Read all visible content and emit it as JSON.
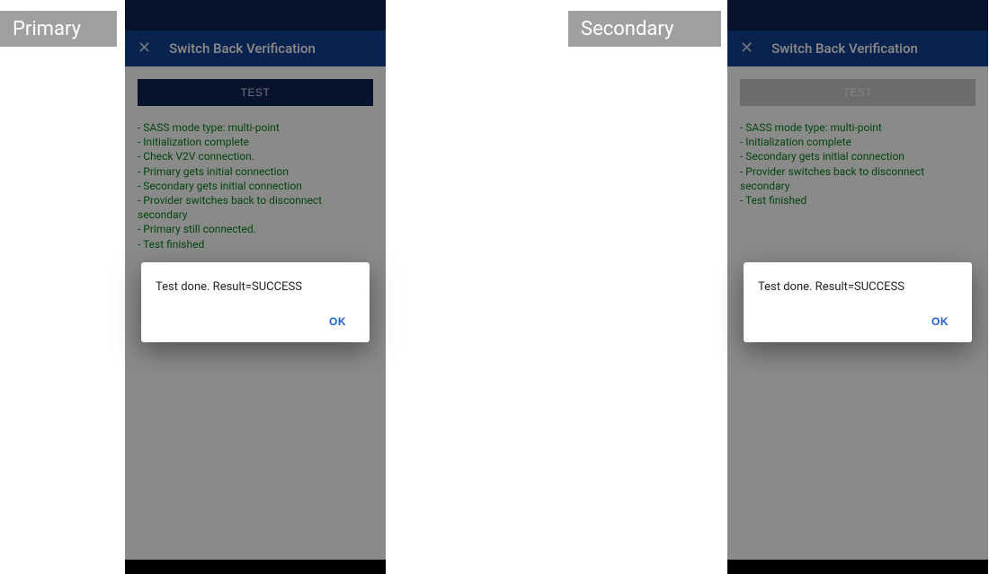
{
  "labels": {
    "primary": "Primary",
    "secondary": "Secondary"
  },
  "primary": {
    "app_bar": {
      "close": "✕",
      "title": "Switch Back Verification"
    },
    "test_button": "TEST",
    "log": [
      "- SASS mode type: multi-point",
      "- Initialization complete",
      "- Check V2V connection.",
      "- Primary gets initial connection",
      "- Secondary gets initial connection",
      "- Provider switches back to disconnect secondary",
      "- Primary still connected.",
      "- Test finished"
    ],
    "dialog": {
      "message": "Test done. Result=SUCCESS",
      "ok": "OK"
    }
  },
  "secondary": {
    "app_bar": {
      "close": "✕",
      "title": "Switch Back Verification"
    },
    "test_button": "TEST",
    "log": [
      "- SASS mode type: multi-point",
      "- Initialization complete",
      "- Secondary gets initial connection",
      "- Provider switches back to disconnect secondary",
      "- Test finished"
    ],
    "dialog": {
      "message": "Test done. Result=SUCCESS",
      "ok": "OK"
    }
  }
}
